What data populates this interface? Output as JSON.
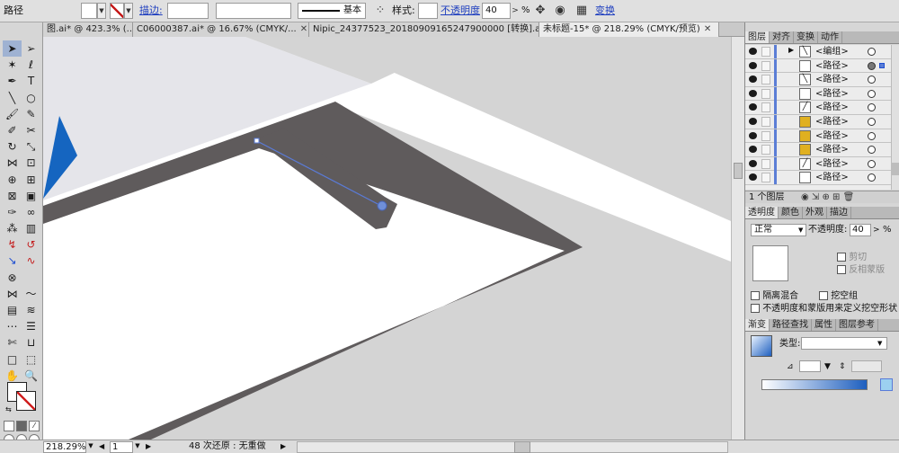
{
  "control_bar": {
    "object_type": "路径",
    "stroke_label": "描边:",
    "profile_label": "基本",
    "style_label": "样式:",
    "opacity_label": "不透明度",
    "opacity_value": "40",
    "opacity_unit": "%",
    "transform_label": "变换"
  },
  "tabs": [
    {
      "title": "图.ai* @ 423.3% (..."
    },
    {
      "title": "C06000387.ai* @ 16.67% (CMYK/..."
    },
    {
      "title": "Nipic_24377523_20180909165247900000 [转换].ai*"
    },
    {
      "title": "未标题-15* @ 218.29% (CMYK/预览)"
    }
  ],
  "status": {
    "zoom": "218.29%",
    "page": "1",
    "history": "48 次还原 : 无重做"
  },
  "layers_panel": {
    "tabs": [
      "图层",
      "对齐",
      "变换",
      "动作"
    ],
    "rows": [
      {
        "label": "<编组>",
        "thumb": "slash"
      },
      {
        "label": "<路径>",
        "thumb": "blank"
      },
      {
        "label": "<路径>",
        "thumb": "slash"
      },
      {
        "label": "<路径>",
        "thumb": "blank"
      },
      {
        "label": "<路径>",
        "thumb": "stroke"
      },
      {
        "label": "<路径>",
        "thumb": "gold"
      },
      {
        "label": "<路径>",
        "thumb": "gold"
      },
      {
        "label": "<路径>",
        "thumb": "gold"
      },
      {
        "label": "<路径>",
        "thumb": "stroke"
      },
      {
        "label": "<路径>",
        "thumb": "blank"
      }
    ],
    "footer": "1 个图层"
  },
  "transparency_panel": {
    "tabs": [
      "透明度",
      "颜色",
      "外观",
      "描边"
    ],
    "blend_mode": "正常",
    "opacity_label": "不透明度:",
    "opacity_value": "40",
    "opacity_unit": "%",
    "clip_label": "剪切",
    "invert_label": "反相蒙版",
    "isolate_label": "隔离混合",
    "knockout_label": "挖空组",
    "define_knockout_label": "不透明度和蒙版用来定义挖空形状"
  },
  "gradient_panel": {
    "tabs": [
      "渐变",
      "路径查找",
      "属性",
      "图层参考"
    ],
    "type_label": "类型:"
  },
  "colors": {
    "ui_blue": "#5b7ed6",
    "wall": "#5f5b5c",
    "floor_gray": "#d4d4d4",
    "highlight_blue": "#5a7bd8",
    "accent_blue": "#1565c0"
  }
}
